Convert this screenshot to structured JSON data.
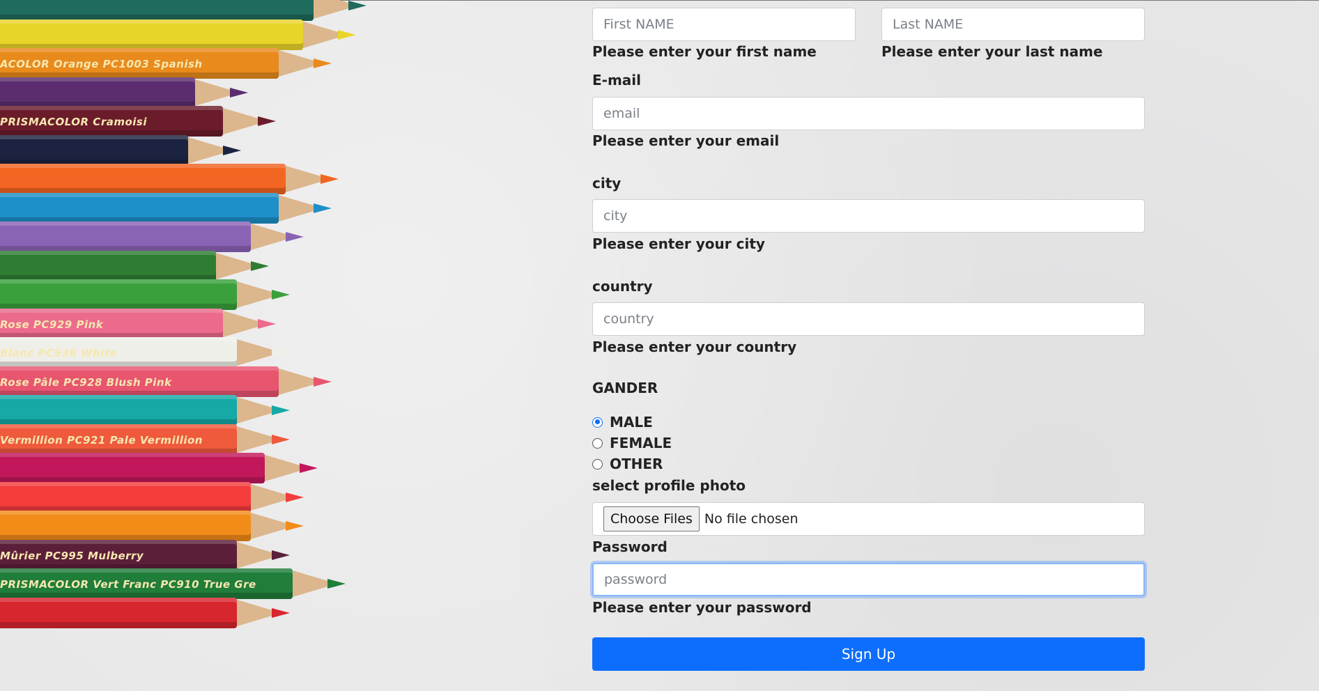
{
  "pencils": [
    {
      "color": "#1f6b5d",
      "label": ""
    },
    {
      "color": "#e9d52a",
      "label": ""
    },
    {
      "color": "#e88a1c",
      "label": "ACOLOR   Orange   PC1003   Spanish"
    },
    {
      "color": "#5b2d6e",
      "label": ""
    },
    {
      "color": "#6b1c2a",
      "label": "PRISMACOLOR   Cramoisi"
    },
    {
      "color": "#1b2340",
      "label": ""
    },
    {
      "color": "#f26522",
      "label": ""
    },
    {
      "color": "#1d8fc9",
      "label": ""
    },
    {
      "color": "#8a63b5",
      "label": ""
    },
    {
      "color": "#2e7d32",
      "label": ""
    },
    {
      "color": "#3aa03c",
      "label": ""
    },
    {
      "color": "#ec6b8c",
      "label": "Rose   PC929   Pink"
    },
    {
      "color": "#efefe9",
      "label": "Blanc   PC938   White"
    },
    {
      "color": "#e8556f",
      "label": "Rose Pâle   PC928   Blush Pink"
    },
    {
      "color": "#16a9a6",
      "label": ""
    },
    {
      "color": "#ef5a3c",
      "label": "Vermillion   PC921   Pale Vermillion"
    },
    {
      "color": "#c2185b",
      "label": ""
    },
    {
      "color": "#f43c3c",
      "label": ""
    },
    {
      "color": "#f28c18",
      "label": ""
    },
    {
      "color": "#5c1f3a",
      "label": "Mûrier   PC995   Mulberry"
    },
    {
      "color": "#207d3a",
      "label": "PRISMACOLOR   Vert Franc   PC910   True Gre"
    },
    {
      "color": "#d8262f",
      "label": ""
    }
  ],
  "form": {
    "first_name": {
      "placeholder": "First NAME",
      "hint": "Please enter your first name"
    },
    "last_name": {
      "placeholder": "Last NAME",
      "hint": "Please enter your last name"
    },
    "email": {
      "label": "E-mail",
      "placeholder": "email",
      "hint": "Please enter your email"
    },
    "city": {
      "label": "city",
      "placeholder": "city",
      "hint": "Please enter your city"
    },
    "country": {
      "label": "country",
      "placeholder": "country",
      "hint": "Please enter your country"
    },
    "gender": {
      "label": "GANDER",
      "options": [
        {
          "label": "MALE",
          "checked": true
        },
        {
          "label": "FEMALE",
          "checked": false
        },
        {
          "label": "OTHER",
          "checked": false
        }
      ]
    },
    "photo": {
      "label": "select profile photo",
      "button": "Choose Files",
      "status": "No file chosen"
    },
    "password": {
      "label": "Password",
      "placeholder": "password",
      "hint": "Please enter your password"
    },
    "submit": "Sign Up"
  },
  "colors": {
    "primary": "#0d6efd",
    "background": "#e7e7e8"
  }
}
